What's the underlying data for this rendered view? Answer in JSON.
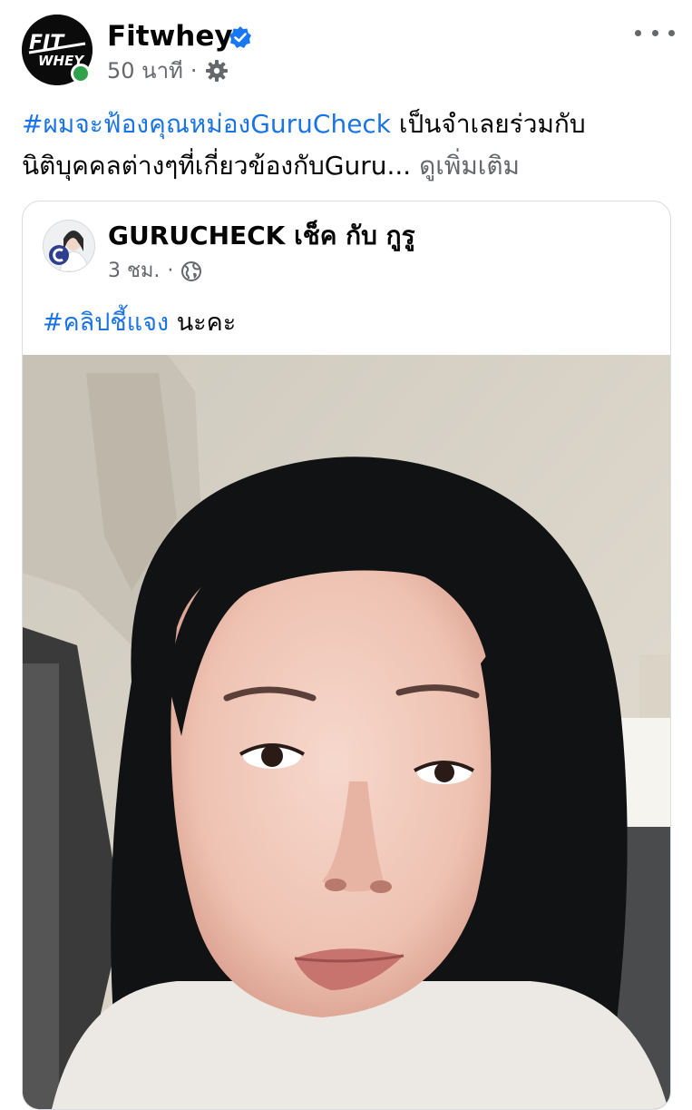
{
  "post": {
    "author": "Fitwhey",
    "time": "50 นาที",
    "separator": "·",
    "caption_hashtag": "#ผมจะฟ้องคุณหม่องGuruCheck",
    "caption_text": " เป็นจำเลยร่วมกับนิติบุคคลต่างๆที่เกี่ยวข้องกับGuru... ",
    "see_more": "ดูเพิ่มเติม",
    "logo_top": "FIT",
    "logo_bottom": "WHEY"
  },
  "shared": {
    "author": "GURUCHECK เช็ค กับ กูรู",
    "time": "3 ชม.",
    "separator": "·",
    "hashtag": "#คลิปชี้แจง",
    "text": " นะคะ"
  },
  "colors": {
    "link": "#1b74e4",
    "muted": "#65676b",
    "online": "#31a24c",
    "verified": "#1877f2"
  }
}
